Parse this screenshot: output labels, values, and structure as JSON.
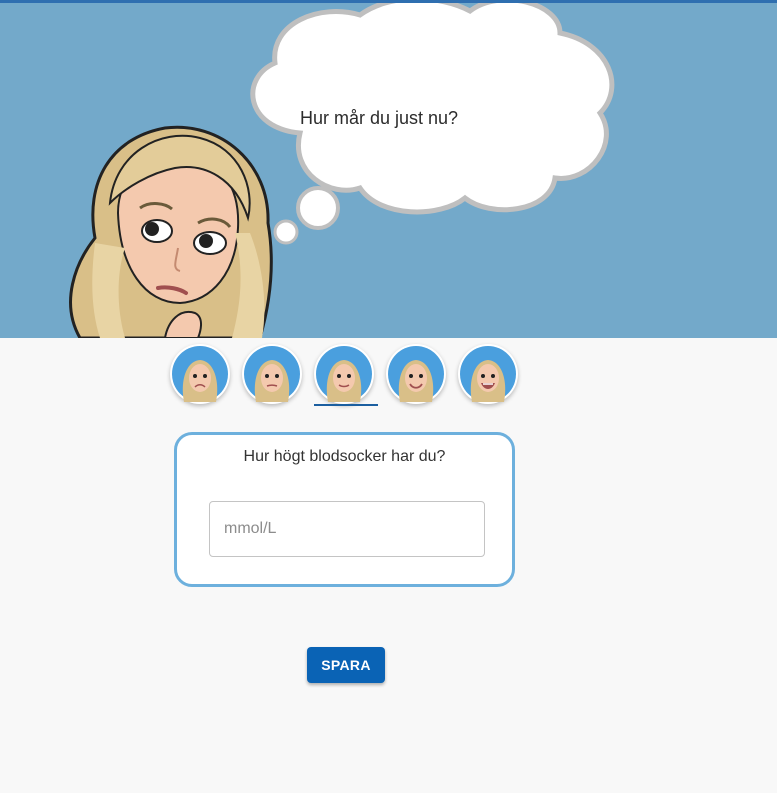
{
  "hero": {
    "question": "Hur mår du just nu?",
    "background_color": "#73a9ca"
  },
  "moods": [
    {
      "name": "very-sad"
    },
    {
      "name": "sad"
    },
    {
      "name": "neutral",
      "selected": true
    },
    {
      "name": "happy"
    },
    {
      "name": "very-happy"
    }
  ],
  "glucose": {
    "question": "Hur högt blodsocker har du?",
    "placeholder": "mmol/L",
    "value": ""
  },
  "actions": {
    "save_label": "SPARA"
  },
  "colors": {
    "accent": "#0a63b5",
    "card_border": "#6db0dd"
  }
}
